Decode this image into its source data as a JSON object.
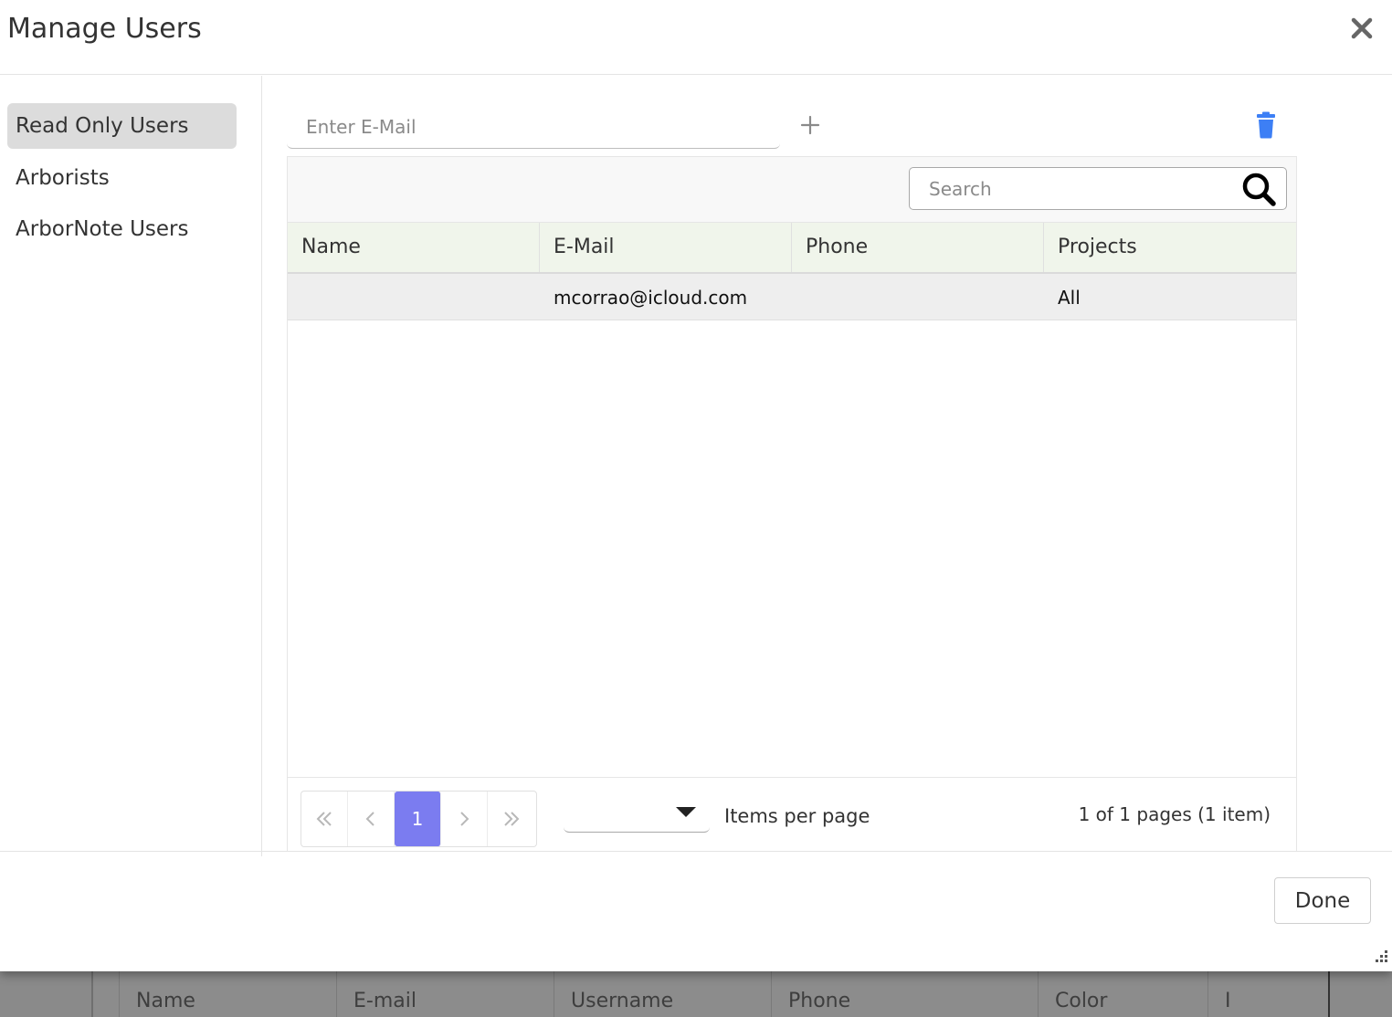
{
  "dialog": {
    "title": "Manage Users",
    "close_icon": "close-icon"
  },
  "sidebar": {
    "items": [
      {
        "label": "Read Only Users",
        "active": true
      },
      {
        "label": "Arborists",
        "active": false
      },
      {
        "label": "ArborNote Users",
        "active": false
      }
    ]
  },
  "email_input": {
    "placeholder": "Enter E-Mail",
    "value": ""
  },
  "toolbar": {
    "add_icon": "plus-icon",
    "delete_icon": "trash-icon",
    "delete_color": "#3d7ff5"
  },
  "grid": {
    "search": {
      "placeholder": "Search",
      "value": ""
    },
    "columns": [
      "Name",
      "E-Mail",
      "Phone",
      "Projects"
    ],
    "rows": [
      {
        "name": "",
        "email": "mcorrao@icloud.com",
        "phone": "",
        "projects": "All"
      }
    ],
    "pager": {
      "current_page": "1",
      "items_per_page_value": "",
      "items_per_page_label": "Items per page",
      "info": "1 of 1 pages (1 item)",
      "accent_color": "#7b7cf0"
    }
  },
  "footer": {
    "done_label": "Done"
  },
  "background_table": {
    "columns": [
      "Name",
      "E-mail",
      "Username",
      "Phone",
      "Color",
      "I"
    ]
  }
}
